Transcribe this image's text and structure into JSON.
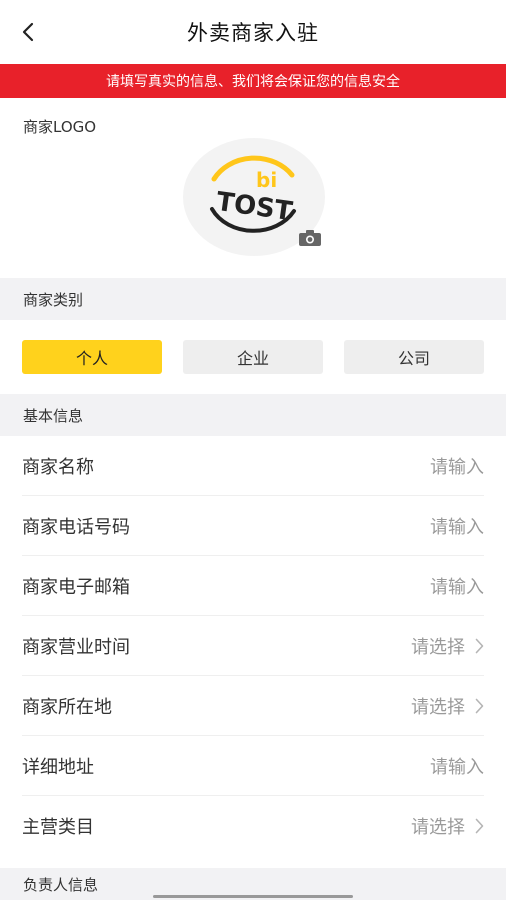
{
  "nav": {
    "title": "外卖商家入驻"
  },
  "notice": {
    "text": "请填写真实的信息、我们将会保证您的信息安全"
  },
  "logo_section": {
    "label": "商家LOGO",
    "logo_text_top": "bi",
    "logo_text_main": "TOST"
  },
  "category": {
    "header": "商家类别",
    "options": [
      {
        "label": "个人",
        "selected": true
      },
      {
        "label": "企业",
        "selected": false
      },
      {
        "label": "公司",
        "selected": false
      }
    ]
  },
  "basic_info": {
    "header": "基本信息",
    "rows": [
      {
        "label": "商家名称",
        "value": "请输入"
      },
      {
        "label": "商家电话号码",
        "value": "请输入"
      },
      {
        "label": "商家电子邮箱",
        "value": "请输入"
      },
      {
        "label": "商家营业时间",
        "value": "请选择"
      },
      {
        "label": "商家所在地",
        "value": "请选择"
      },
      {
        "label": "详细地址",
        "value": "请输入"
      },
      {
        "label": "主营类目",
        "value": "请选择"
      }
    ]
  },
  "owner_info": {
    "header": "负责人信息"
  },
  "colors": {
    "accent": "#ffd21c",
    "notice": "#e8212a"
  }
}
